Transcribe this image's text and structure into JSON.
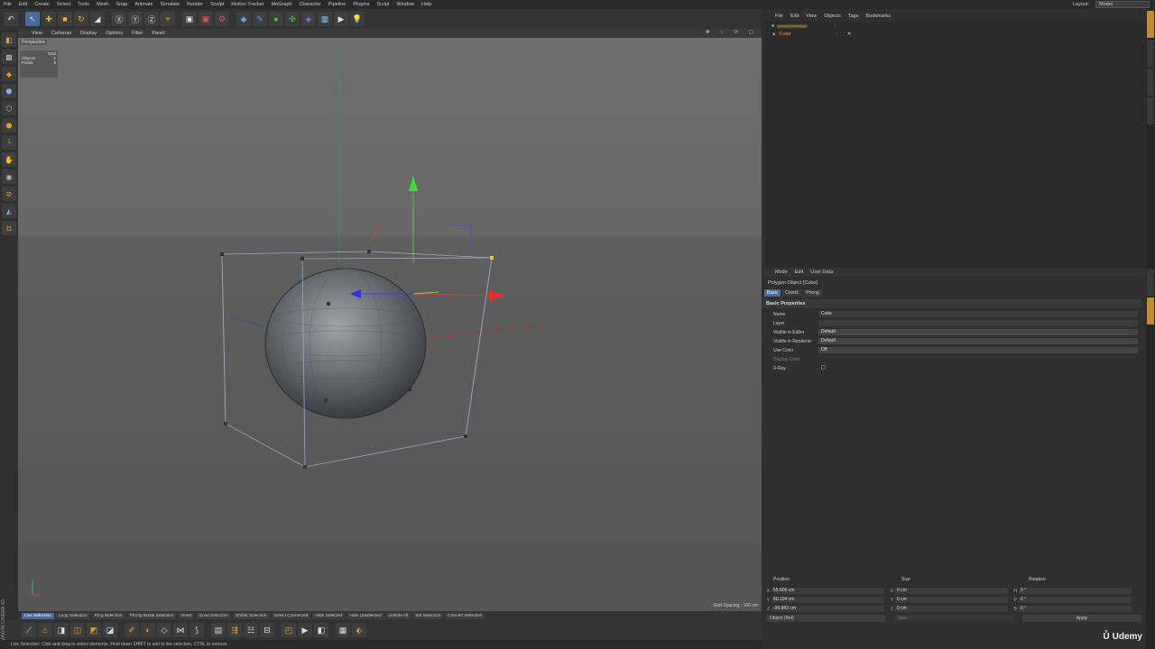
{
  "menubar": {
    "items": [
      "File",
      "Edit",
      "Create",
      "Select",
      "Tools",
      "Mesh",
      "Snap",
      "Animate",
      "Simulate",
      "Render",
      "Sculpt",
      "Motion Tracker",
      "MoGraph",
      "Character",
      "Pipeline",
      "Plugins",
      "Script",
      "Window",
      "Help"
    ],
    "layout_label": "Layout:",
    "layout_value": "Model"
  },
  "viewport": {
    "menu": [
      "View",
      "Cameras",
      "Display",
      "Options",
      "Filter",
      "Panel"
    ],
    "view_name": "Perspective",
    "stats": {
      "header": "Total",
      "objects_label": "Objects",
      "objects_value": "1",
      "points_label": "Points",
      "points_value": "8"
    },
    "grid_spacing": "Grid Spacing : 100 cm"
  },
  "selection_bar": [
    "Live Selection",
    "Loop Selection",
    "Ring Selection",
    "Phong Break Selection",
    "Invert",
    "Grow Selection",
    "Shrink Selection",
    "Select Connected",
    "Hide Selected",
    "Hide Unselected",
    "Unhide All",
    "Set Selection",
    "Convert Selection"
  ],
  "status": "Live Selection: Click and drag to select elements. Hold down SHIFT to add to the selection, CTRL to remove.",
  "brand": "MAXON CINEMA 4D",
  "objects": {
    "menu": [
      "File",
      "Edit",
      "View",
      "Objects",
      "Tags",
      "Bookmarks"
    ],
    "rows": [
      {
        "name": "Cube"
      }
    ]
  },
  "attributes": {
    "menu": [
      "Mode",
      "Edit",
      "User Data"
    ],
    "title": "Polygon Object [Cube]",
    "tabs": [
      "Basic",
      "Coord.",
      "Phong"
    ],
    "section": "Basic Properties",
    "props": [
      {
        "label": "Name",
        "value": "Cube"
      },
      {
        "label": "Layer",
        "value": ""
      },
      {
        "label": "Visible in Editor",
        "value": "Default"
      },
      {
        "label": "Visible in Renderer",
        "value": "Default"
      },
      {
        "label": "Use Color",
        "value": "Off"
      },
      {
        "label": "Display Color",
        "value": ""
      },
      {
        "label": "X-Ray",
        "value": ""
      }
    ]
  },
  "coordinates": {
    "headers": [
      "Position",
      "Size",
      "Rotation"
    ],
    "position": [
      "55.606 cm",
      "50.104 cm",
      "-90.883 cm"
    ],
    "size": [
      "0 cm",
      "0 cm",
      "0 cm"
    ],
    "rotation": [
      "0 °",
      "0 °",
      "0 °"
    ],
    "axes_pos": [
      "X",
      "Y",
      "Z"
    ],
    "axes_rot": [
      "H",
      "P",
      "B"
    ],
    "mode": "Object (Rel)",
    "size_mode": "Size",
    "apply": "Apply"
  },
  "watermark": "Udemy"
}
